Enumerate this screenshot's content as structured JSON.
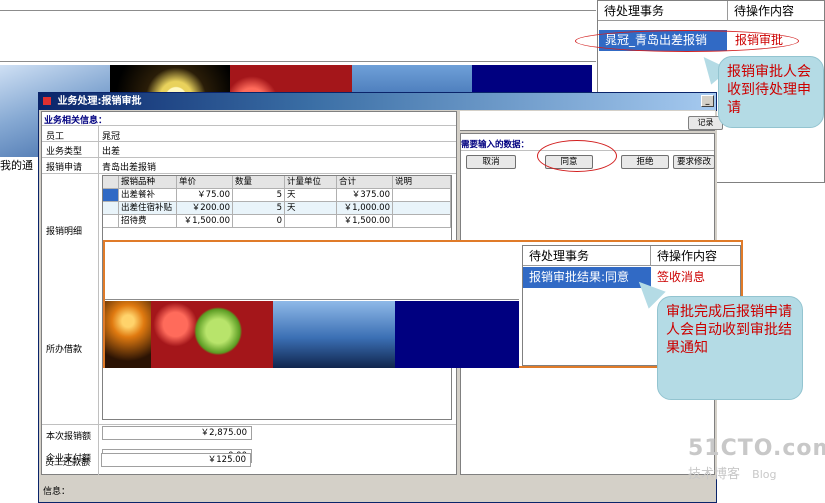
{
  "background": {
    "left_text": "我的通",
    "pending_table": {
      "headers": [
        "待处理事务",
        "待操作内容"
      ],
      "row": {
        "task": "晁冠_青岛出差报销",
        "action": "报销审批"
      }
    }
  },
  "dialog": {
    "title": "业务处理:报销审批",
    "minimize_glyph": "_",
    "section_label": "业务相关信息：",
    "fields": [
      {
        "label": "员工",
        "value": "晁冠"
      },
      {
        "label": "业务类型",
        "value": "出差"
      },
      {
        "label": "报销申请",
        "value": "青岛出差报销"
      }
    ],
    "detail_label": "报销明细",
    "detail_table": {
      "headers": [
        "报销品种",
        "单价",
        "数量",
        "计量单位",
        "合计",
        "说明"
      ],
      "rows": [
        [
          "出差餐补",
          "￥75.00",
          "5",
          "天",
          "￥375.00",
          ""
        ],
        [
          "出差住宿补贴",
          "￥200.00",
          "5",
          "天",
          "￥1,000.00",
          ""
        ],
        [
          "招待费",
          "￥1,500.00",
          "0",
          "",
          "￥1,500.00",
          ""
        ]
      ]
    },
    "loan_label": "所办借款",
    "amounts": [
      {
        "label": "本次报销额",
        "value": "￥2,875.00"
      },
      {
        "label": "企业支付额",
        "value": "0.00"
      },
      {
        "label": "员工还款额",
        "value": "￥125.00"
      }
    ],
    "status_label": "信息：",
    "right": {
      "record_button": "记录",
      "input_label": "需要输入的数据：",
      "buttons": {
        "cancel": "取消",
        "agree": "同意",
        "reject": "拒绝",
        "modify": "要求修改"
      }
    }
  },
  "overlay": {
    "pending_table": {
      "headers": [
        "待处理事务",
        "待操作内容"
      ],
      "row": {
        "task": "报销审批结果:同意",
        "action": "签收消息"
      }
    }
  },
  "callouts": {
    "first": "报销审批人会收到待处理申请",
    "second": "审批完成后报销申请人会自动收到审批结果通知"
  },
  "watermark": {
    "main": "51CTO.com",
    "sub": "技术博客",
    "blog": "Blog"
  },
  "colors": {
    "selection": "#316ac5",
    "title_bar": "#0a246a",
    "callout_bg": "#b4dbe5",
    "callout_text": "#cc0000",
    "action_text": "#cc0000",
    "highlight_border": "#e07b29"
  }
}
